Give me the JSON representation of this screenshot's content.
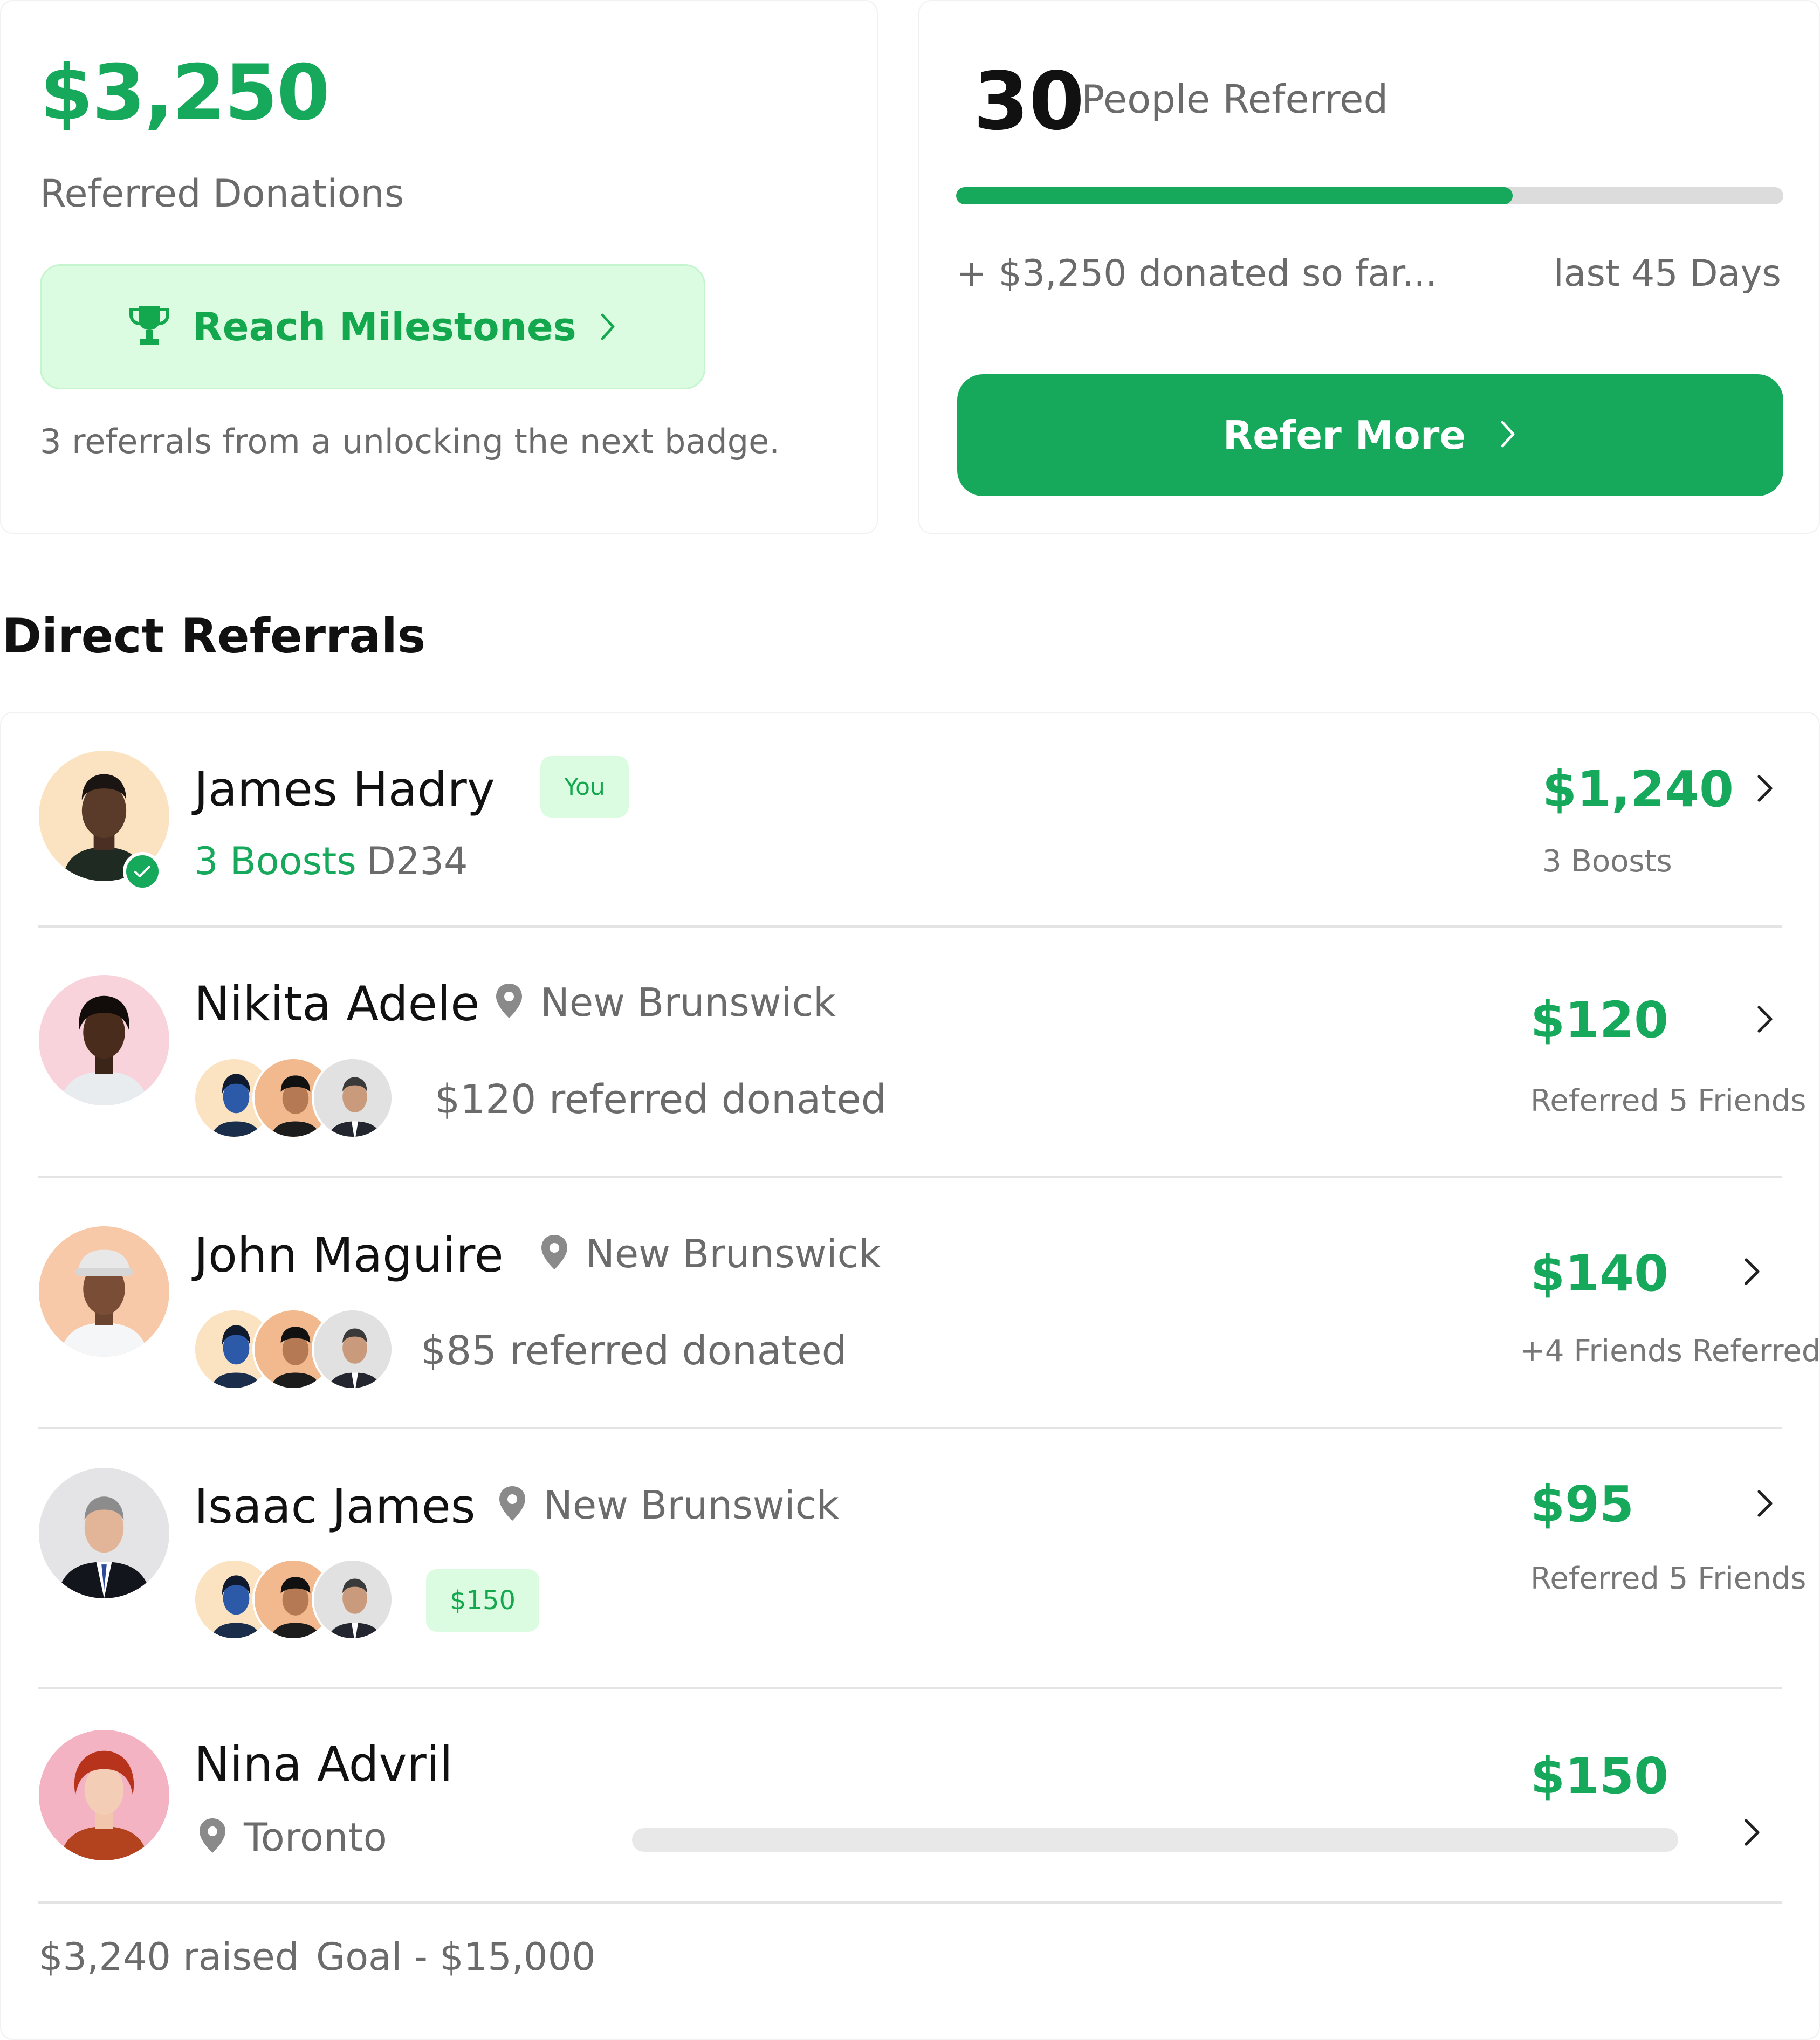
{
  "colors": {
    "accent": "#16a95c",
    "accent_light": "#dcfce2",
    "muted_text": "#6b6b6b",
    "divider": "#e4e4e4"
  },
  "donations_card": {
    "amount": "$3,250",
    "label": "Referred Donations",
    "milestone_button": {
      "label": "Reach Milestones",
      "icon": "trophy-icon"
    },
    "hint": "3 referrals from a unlocking the next badge."
  },
  "referred_card": {
    "count": "30",
    "label": "People Referred",
    "progress": 0.673,
    "donated_note": "+ $3,250 donated so far...",
    "period": "last 45 Days",
    "refer_button": {
      "label": "Refer More"
    }
  },
  "section": {
    "title": "Direct Referrals"
  },
  "referrals": [
    {
      "name": "James Hadry",
      "you_badge": "You",
      "boosts": "3 Boosts",
      "code": "D234",
      "amount": "$1,240",
      "sub": "3 Boosts"
    },
    {
      "name": "Nikita Adele",
      "location": "New Brunswick",
      "note": "$120 referred donated",
      "amount": "$120",
      "sub": "Referred 5 Friends"
    },
    {
      "name": "John Maguire",
      "location": "New Brunswick",
      "note": "$85 referred donated",
      "amount": "$140",
      "sub": "+4 Friends Referred"
    },
    {
      "name": "Isaac James",
      "location": "New Brunswick",
      "badge": "$150",
      "amount": "$95",
      "sub": "Referred 5 Friends"
    },
    {
      "name": "Nina Advril",
      "location": "Toronto",
      "amount": "$150",
      "progress": 0
    }
  ],
  "footer": {
    "raised": "$3,240 raised",
    "goal": "Goal - $15,000"
  }
}
